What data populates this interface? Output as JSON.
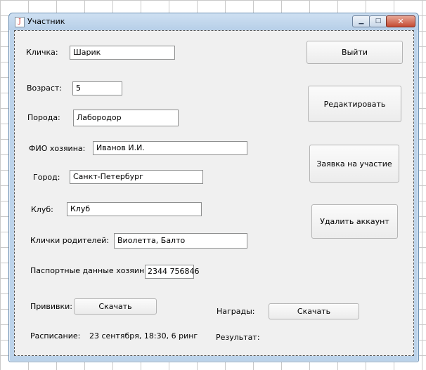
{
  "window": {
    "title": "Участник",
    "min_icon": "minimize-icon",
    "max_icon": "maximize-icon",
    "close_icon": "close-icon",
    "min_glyph": "▁",
    "max_glyph": "□",
    "close_glyph": "✕",
    "app_icon": "java-icon",
    "app_glyph": "J"
  },
  "form": {
    "nickname_label": "Кличка:",
    "nickname_value": "Шарик",
    "age_label": "Возраст:",
    "age_value": "5",
    "breed_label": "Порода:",
    "breed_value": "Лабородор",
    "owner_label": "ФИО хозяина:",
    "owner_value": "Иванов И.И.",
    "city_label": "Город:",
    "city_value": "Санкт-Петербург",
    "club_label": "Клуб:",
    "club_value": "Клуб",
    "parents_label": "Клички родителей:",
    "parents_value": "Виолетта, Балто",
    "passport_label": "Паспортные данные хозяина:",
    "passport_value": "2344 756846",
    "vaccines_label": "Прививки:",
    "vaccines_button": "Скачать",
    "awards_label": "Награды:",
    "awards_button": "Скачать",
    "schedule_label": "Расписание:",
    "schedule_value": "23 сентября, 18:30, 6 ринг",
    "result_label": "Результат:"
  },
  "actions": {
    "exit": "Выйти",
    "edit": "Редактировать",
    "apply": "Заявка на участие",
    "delete": "Удалить аккаунт"
  },
  "colors": {
    "frame": "#bcd3ea",
    "close_button": "#c44a32",
    "content": "#f0f0f0"
  }
}
